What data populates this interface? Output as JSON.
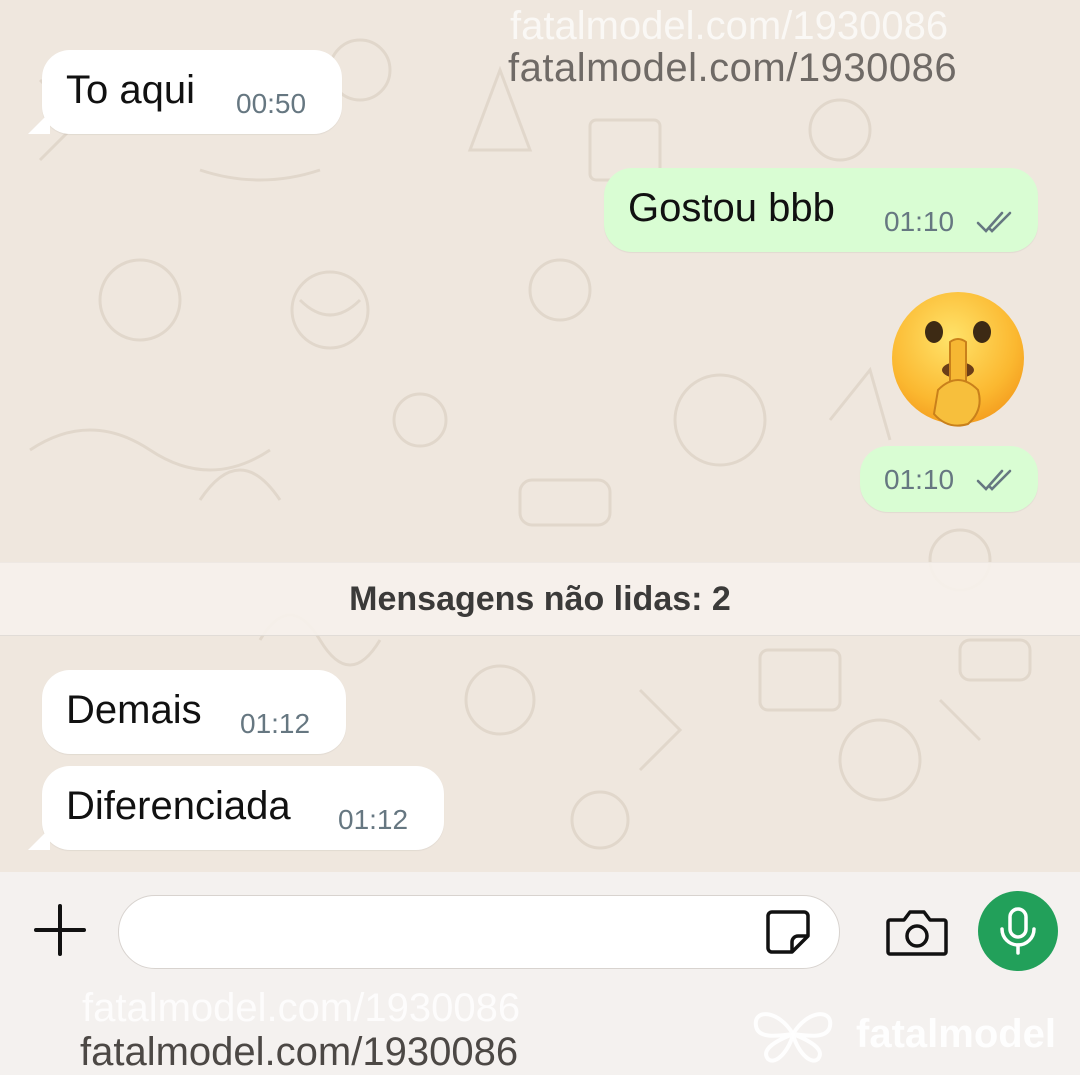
{
  "chat": {
    "messages": [
      {
        "direction": "incoming",
        "text": "To aqui",
        "time": "00:50"
      },
      {
        "direction": "outgoing",
        "text": "Gostou bbb",
        "time": "01:10",
        "status": "read-double-check"
      },
      {
        "direction": "outgoing",
        "emoji": "shushing-face",
        "time": "01:10",
        "status": "read-double-check"
      },
      {
        "direction": "incoming",
        "text": "Demais",
        "time": "01:12"
      },
      {
        "direction": "incoming",
        "text": "Diferenciada",
        "time": "01:12"
      }
    ],
    "unread_banner": "Mensagens não lidas: 2"
  },
  "composer": {
    "placeholder": "",
    "icons": [
      "plus-icon",
      "sticker-icon",
      "camera-icon",
      "microphone-icon"
    ]
  },
  "watermarks": {
    "top": "fatalmodel.com/1930086",
    "bottom": "fatalmodel.com/1930086",
    "brand": "fatalmodel"
  },
  "colors": {
    "chat_background": "#efe7de",
    "outgoing_bubble": "#d9fdd3",
    "incoming_bubble": "#ffffff",
    "mic_button": "#22a05a",
    "read_check": "#667781"
  }
}
